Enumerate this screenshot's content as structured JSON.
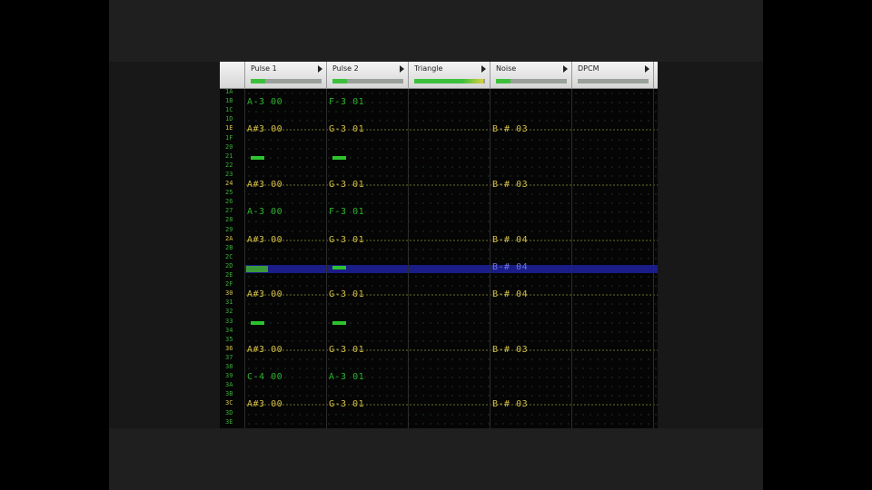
{
  "channels": [
    {
      "name": "Pulse 1",
      "level": 0.2
    },
    {
      "name": "Pulse 2",
      "level": 0.2
    },
    {
      "name": "Triangle",
      "level": 0.98
    },
    {
      "name": "Noise",
      "level": 0.2
    },
    {
      "name": "DPCM",
      "level": 0.0
    }
  ],
  "rows": [
    "1A",
    "1B",
    "1C",
    "1D",
    "1E",
    "1F",
    "20",
    "21",
    "22",
    "23",
    "24",
    "25",
    "26",
    "27",
    "28",
    "29",
    "2A",
    "2B",
    "2C",
    "2D",
    "2E",
    "2F",
    "30",
    "31",
    "32",
    "33",
    "34",
    "35",
    "36",
    "37",
    "38",
    "39",
    "3A",
    "3B",
    "3C",
    "3D",
    "3E"
  ],
  "cursor_row": "2D",
  "notes": [
    {
      "row": "1B",
      "channel": 0,
      "text": "A-3 00",
      "style": "green"
    },
    {
      "row": "1B",
      "channel": 1,
      "text": "F-3 01",
      "style": "green"
    },
    {
      "row": "1E",
      "channel": 0,
      "text": "A#3 00",
      "style": "yellow"
    },
    {
      "row": "1E",
      "channel": 1,
      "text": "G-3 01",
      "style": "yellow"
    },
    {
      "row": "1E",
      "channel": 3,
      "text": "B-# 03",
      "style": "yellow"
    },
    {
      "row": "21",
      "channel": 0,
      "text": "===",
      "style": "cut"
    },
    {
      "row": "21",
      "channel": 1,
      "text": "===",
      "style": "cut"
    },
    {
      "row": "24",
      "channel": 0,
      "text": "A#3 00",
      "style": "yellow"
    },
    {
      "row": "24",
      "channel": 1,
      "text": "G-3 01",
      "style": "yellow"
    },
    {
      "row": "24",
      "channel": 3,
      "text": "B-# 03",
      "style": "yellow"
    },
    {
      "row": "27",
      "channel": 0,
      "text": "A-3 00",
      "style": "green"
    },
    {
      "row": "27",
      "channel": 1,
      "text": "F-3 01",
      "style": "green"
    },
    {
      "row": "2A",
      "channel": 0,
      "text": "A#3 00",
      "style": "yellow"
    },
    {
      "row": "2A",
      "channel": 1,
      "text": "G-3 01",
      "style": "yellow"
    },
    {
      "row": "2A",
      "channel": 3,
      "text": "B-# 04",
      "style": "yellow"
    },
    {
      "row": "2D",
      "channel": 0,
      "text": "===",
      "style": "cut-cursor"
    },
    {
      "row": "2D",
      "channel": 1,
      "text": "===",
      "style": "cut"
    },
    {
      "row": "2D",
      "channel": 3,
      "text": "B-# 04",
      "style": "blue"
    },
    {
      "row": "30",
      "channel": 0,
      "text": "A#3 00",
      "style": "yellow"
    },
    {
      "row": "30",
      "channel": 1,
      "text": "G-3 01",
      "style": "yellow"
    },
    {
      "row": "30",
      "channel": 3,
      "text": "B-# 04",
      "style": "yellow"
    },
    {
      "row": "33",
      "channel": 0,
      "text": "===",
      "style": "cut"
    },
    {
      "row": "33",
      "channel": 1,
      "text": "===",
      "style": "cut"
    },
    {
      "row": "36",
      "channel": 0,
      "text": "A#3 00",
      "style": "yellow"
    },
    {
      "row": "36",
      "channel": 1,
      "text": "G-3 01",
      "style": "yellow"
    },
    {
      "row": "36",
      "channel": 3,
      "text": "B-# 03",
      "style": "yellow"
    },
    {
      "row": "39",
      "channel": 0,
      "text": "C-4 00",
      "style": "green"
    },
    {
      "row": "39",
      "channel": 1,
      "text": "A-3 01",
      "style": "green"
    },
    {
      "row": "3C",
      "channel": 0,
      "text": "A#3 00",
      "style": "yellow"
    },
    {
      "row": "3C",
      "channel": 1,
      "text": "G-3 01",
      "style": "yellow"
    },
    {
      "row": "3C",
      "channel": 3,
      "text": "B-# 03",
      "style": "yellow"
    }
  ],
  "colors": {
    "note_green": "#2db22d",
    "note_yellow": "#d6bf46",
    "cursor": "#1a1c88",
    "meter": "#3cc03c"
  }
}
